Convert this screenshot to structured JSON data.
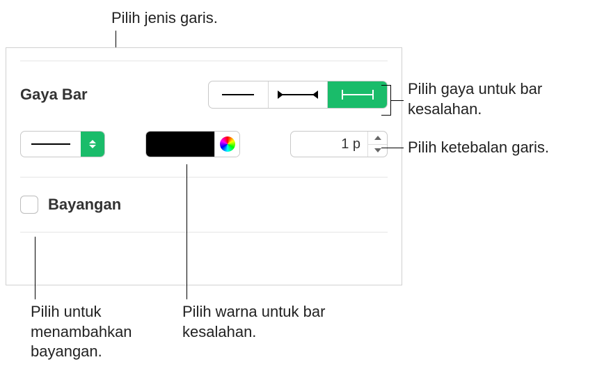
{
  "panel": {
    "section_label": "Gaya Bar",
    "line_thickness_value": "1 p",
    "checkbox_label": "Bayangan",
    "color_swatch": "#000000",
    "selected_style_index": 2,
    "styles": [
      "plain",
      "arrows",
      "caps"
    ]
  },
  "callouts": {
    "line_type": "Pilih jenis garis.",
    "bar_style": "Pilih gaya untuk bar kesalahan.",
    "thickness": "Pilih ketebalan garis.",
    "shadow": "Pilih untuk menambahkan bayangan.",
    "color": "Pilih warna untuk bar kesalahan."
  }
}
